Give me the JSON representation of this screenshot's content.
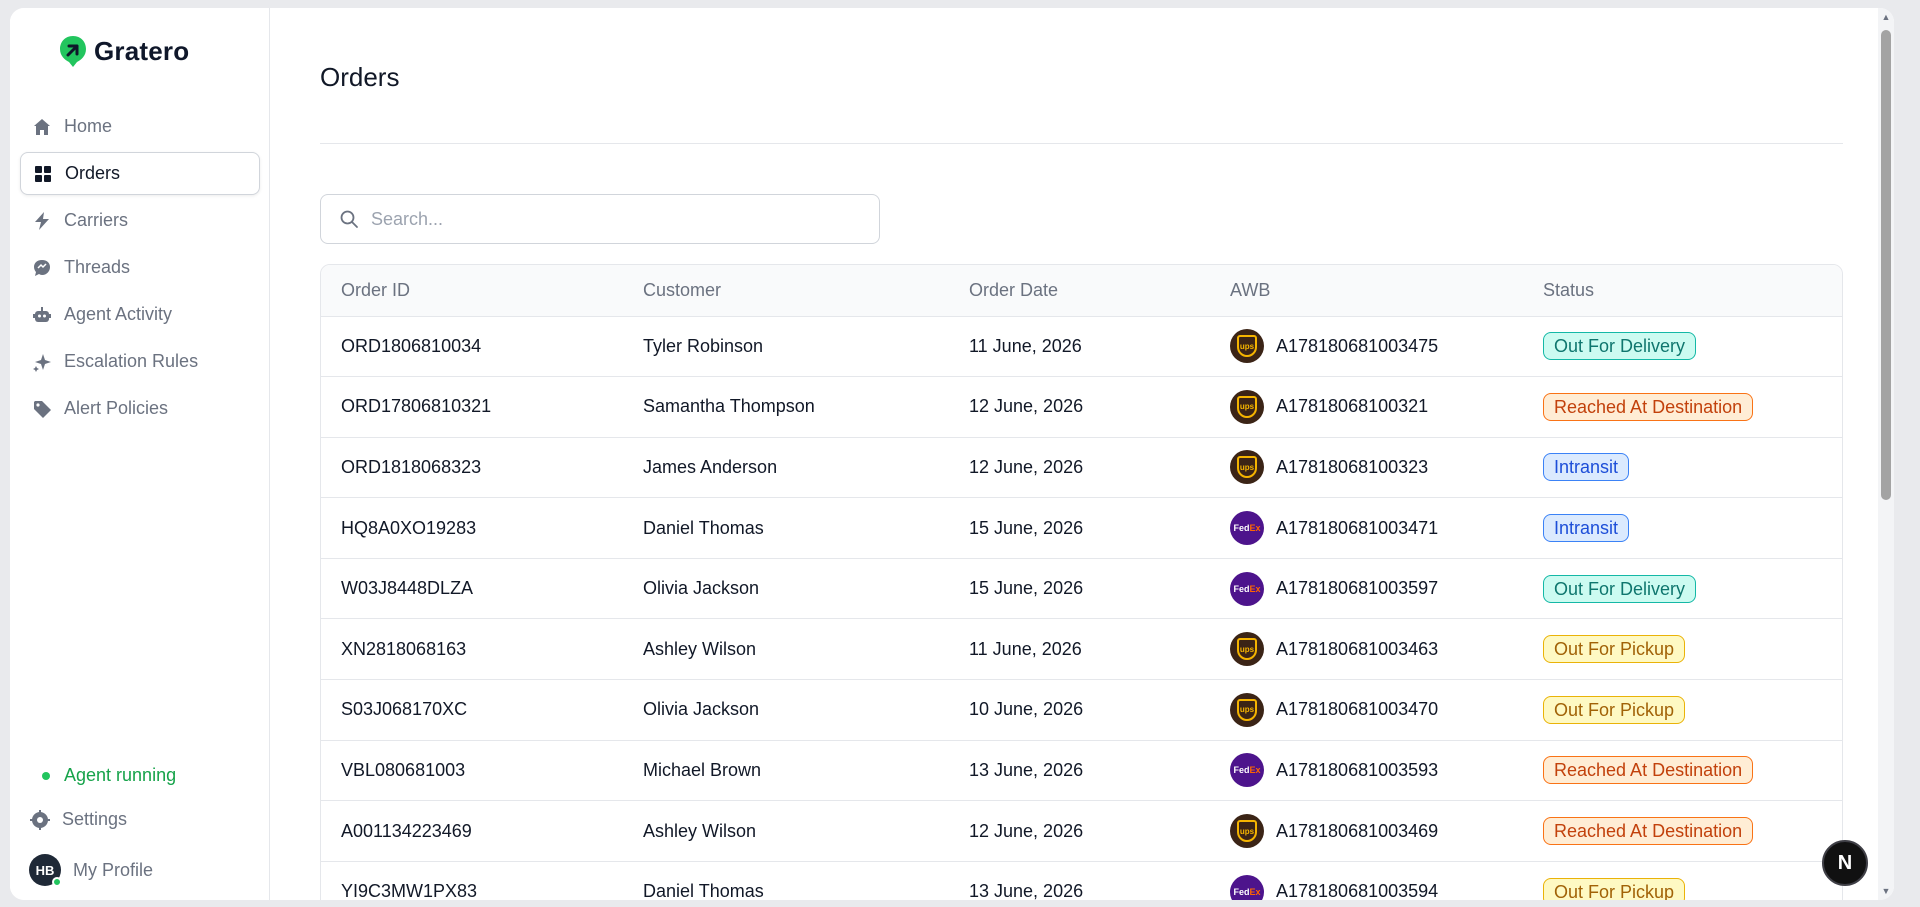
{
  "brand": {
    "name": "Gratero"
  },
  "sidebar": {
    "items": [
      {
        "label": "Home",
        "icon": "home-icon"
      },
      {
        "label": "Orders",
        "icon": "grid-icon",
        "active": true
      },
      {
        "label": "Carriers",
        "icon": "bolt-icon"
      },
      {
        "label": "Threads",
        "icon": "chat-icon"
      },
      {
        "label": "Agent Activity",
        "icon": "robot-icon"
      },
      {
        "label": "Escalation Rules",
        "icon": "sparkle-icon"
      },
      {
        "label": "Alert Policies",
        "icon": "tag-icon"
      }
    ],
    "agent_status": "Agent running",
    "settings_label": "Settings",
    "profile": {
      "initials": "HB",
      "label": "My Profile"
    }
  },
  "main": {
    "title": "Orders",
    "search": {
      "placeholder": "Search...",
      "value": ""
    },
    "table": {
      "headers": [
        "Order ID",
        "Customer",
        "Order Date",
        "AWB",
        "Status"
      ],
      "rows": [
        {
          "order_id": "ORD1806810034",
          "customer": "Tyler Robinson",
          "date": "11 June, 2026",
          "carrier": "ups",
          "awb": "A178180681003475",
          "status": "Out For Delivery",
          "status_type": "delivery"
        },
        {
          "order_id": "ORD17806810321",
          "customer": "Samantha Thompson",
          "date": "12 June, 2026",
          "carrier": "ups",
          "awb": "A17818068100321",
          "status": "Reached At Destination",
          "status_type": "destination"
        },
        {
          "order_id": "ORD1818068323",
          "customer": "James Anderson",
          "date": "12 June, 2026",
          "carrier": "ups",
          "awb": "A17818068100323",
          "status": "Intransit",
          "status_type": "intransit"
        },
        {
          "order_id": "HQ8A0XO19283",
          "customer": "Daniel Thomas",
          "date": "15 June, 2026",
          "carrier": "fedex",
          "awb": "A178180681003471",
          "status": "Intransit",
          "status_type": "intransit"
        },
        {
          "order_id": "W03J8448DLZA",
          "customer": "Olivia Jackson",
          "date": "15 June, 2026",
          "carrier": "fedex",
          "awb": "A178180681003597",
          "status": "Out For Delivery",
          "status_type": "delivery"
        },
        {
          "order_id": "XN2818068163",
          "customer": "Ashley Wilson",
          "date": "11 June, 2026",
          "carrier": "ups",
          "awb": "A178180681003463",
          "status": "Out For Pickup",
          "status_type": "pickup"
        },
        {
          "order_id": "S03J068170XC",
          "customer": "Olivia Jackson",
          "date": "10 June, 2026",
          "carrier": "ups",
          "awb": "A178180681003470",
          "status": "Out For Pickup",
          "status_type": "pickup"
        },
        {
          "order_id": "VBL080681003",
          "customer": "Michael Brown",
          "date": "13 June, 2026",
          "carrier": "fedex",
          "awb": "A178180681003593",
          "status": "Reached At Destination",
          "status_type": "destination"
        },
        {
          "order_id": "A001134223469",
          "customer": "Ashley Wilson",
          "date": "12 June, 2026",
          "carrier": "ups",
          "awb": "A178180681003469",
          "status": "Reached At Destination",
          "status_type": "destination"
        },
        {
          "order_id": "YI9C3MW1PX83",
          "customer": "Daniel Thomas",
          "date": "13 June, 2026",
          "carrier": "fedex",
          "awb": "A178180681003594",
          "status": "Out For Pickup",
          "status_type": "pickup"
        }
      ]
    }
  },
  "carrier_logos": {
    "ups": "ups",
    "fedex_fed": "Fed",
    "fedex_ex": "Ex"
  },
  "floating_button": {
    "label": "N"
  },
  "colors": {
    "brand_green": "#22c55e",
    "delivery": "#14b8a6",
    "destination": "#f97316",
    "intransit": "#3b82f6",
    "pickup": "#eab308"
  }
}
